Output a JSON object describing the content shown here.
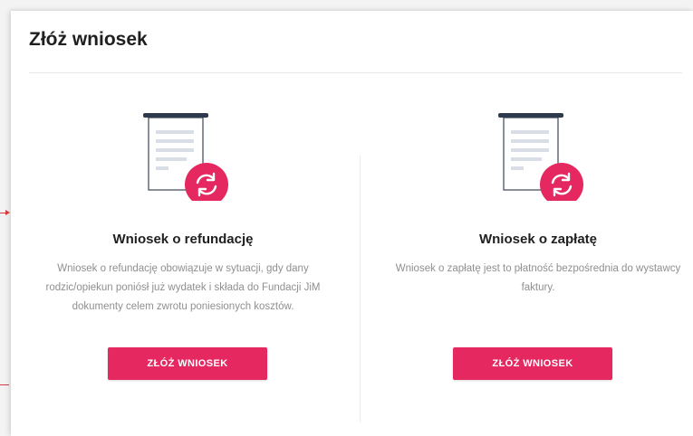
{
  "page": {
    "title": "Złóż wniosek"
  },
  "cards": [
    {
      "title": "Wniosek o refundację",
      "description": "Wniosek o refundację obowiązuje w sytuacji, gdy dany rodzic/opiekun poniósł już wydatek i składa do Fundacji JiM dokumenty celem zwrotu poniesionych kosztów.",
      "button_label": "ZŁÓŻ WNIOSEK",
      "icon": "document-refresh-icon"
    },
    {
      "title": "Wniosek o zapłatę",
      "description": "Wniosek o zapłatę jest to płatność bezpośrednia do wystawcy faktury.",
      "button_label": "ZŁÓŻ WNIOSEK",
      "icon": "document-refresh-icon"
    }
  ],
  "colors": {
    "accent": "#e5285f",
    "doc_top": "#2f3b4d",
    "doc_lines": "#d9dde5"
  }
}
